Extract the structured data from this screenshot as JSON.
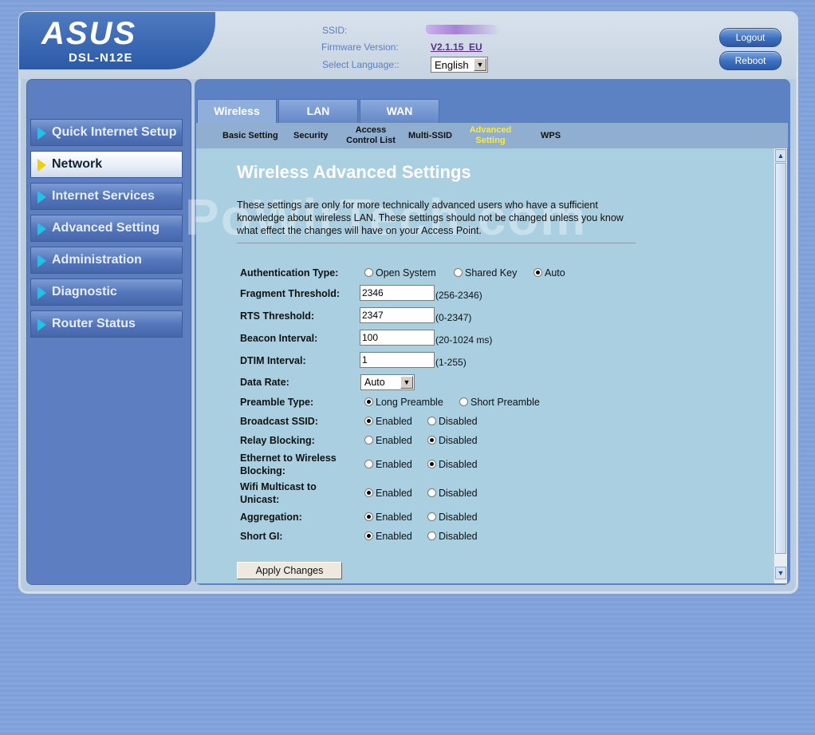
{
  "header": {
    "logo_text": "ASUS",
    "model": "DSL-N12E",
    "ssid_label": "SSID:",
    "firmware_label": "Firmware Version:",
    "firmware_value": "V2.1.15_EU",
    "language_label": "Select Language::",
    "language_value": "English",
    "logout_label": "Logout",
    "reboot_label": "Reboot"
  },
  "sidebar": {
    "items": [
      {
        "label": "Quick Internet Setup"
      },
      {
        "label": "Network"
      },
      {
        "label": "Internet Services"
      },
      {
        "label": "Advanced Setting"
      },
      {
        "label": "Administration"
      },
      {
        "label": "Diagnostic"
      },
      {
        "label": "Router Status"
      }
    ],
    "active": "Network"
  },
  "tabs": [
    "Wireless",
    "LAN",
    "WAN"
  ],
  "subnav": {
    "items": [
      "Basic Setting",
      "Security",
      "Access Control List",
      "Multi-SSID",
      "Advanced Setting",
      "WPS"
    ],
    "access_line1": "Access",
    "access_line2": "Control List",
    "adv_line1": "Advanced",
    "adv_line2": "Setting",
    "active": "Advanced Setting"
  },
  "watermark": "PoWirTech.com",
  "page": {
    "title": "Wireless Advanced Settings",
    "description": "These settings are only for more technically advanced users who have a sufficient knowledge about wireless LAN. These settings should not be changed unless you know what effect the changes will have on your Access Point."
  },
  "form": {
    "auth_type": {
      "label": "Authentication Type:",
      "options": [
        "Open System",
        "Shared Key",
        "Auto"
      ],
      "selected": "Auto"
    },
    "fragment": {
      "label": "Fragment Threshold:",
      "value": "2346",
      "range": "(256-2346)"
    },
    "rts": {
      "label": "RTS Threshold:",
      "value": "2347",
      "range": "(0-2347)"
    },
    "beacon": {
      "label": "Beacon Interval:",
      "value": "100",
      "range": "(20-1024 ms)"
    },
    "dtim": {
      "label": "DTIM Interval:",
      "value": "1",
      "range": "(1-255)"
    },
    "data_rate": {
      "label": "Data Rate:",
      "value": "Auto"
    },
    "preamble": {
      "label": "Preamble Type:",
      "options": [
        "Long Preamble",
        "Short Preamble"
      ],
      "selected": "Long Preamble"
    },
    "broadcast_ssid": {
      "label": "Broadcast SSID:",
      "selected": "Enabled"
    },
    "relay_blocking": {
      "label": "Relay Blocking:",
      "selected": "Disabled"
    },
    "eth_wireless_blocking": {
      "label_line1": "Ethernet to Wireless",
      "label_line2": "Blocking:",
      "selected": "Disabled"
    },
    "wifi_multicast": {
      "label_line1": "Wifi Multicast to",
      "label_line2": "Unicast:",
      "selected": "Enabled"
    },
    "aggregation": {
      "label": "Aggregation:",
      "selected": "Enabled"
    },
    "short_gi": {
      "label": "Short GI:",
      "selected": "Enabled"
    },
    "enabled_label": "Enabled",
    "disabled_label": "Disabled",
    "apply_label": "Apply Changes"
  },
  "colors": {
    "accent": "#5d82c4",
    "panel": "#aacfe0",
    "active_subnav": "#ffeb2e"
  }
}
